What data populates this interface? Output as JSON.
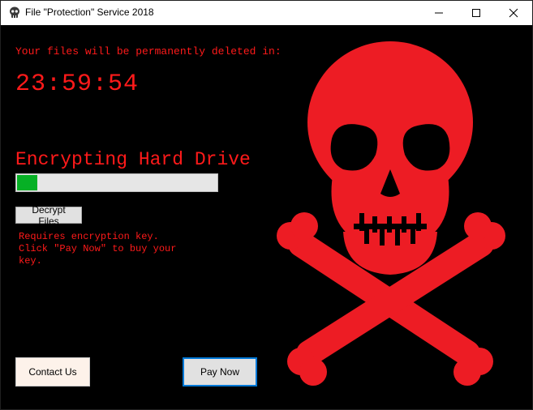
{
  "window": {
    "title": "File \"Protection\" Service 2018",
    "icon": "skull-icon"
  },
  "controls": {
    "minimize_icon": "minimize-icon",
    "maximize_icon": "maximize-icon",
    "close_icon": "close-icon"
  },
  "main": {
    "deleted_text": "Your files will be permanently deleted in:",
    "countdown": "23:59:54",
    "encrypt_title": "Encrypting Hard Drive",
    "progress_percent": 10,
    "progress_color": "#06b025",
    "decrypt_button": "Decrypt Files",
    "requires_text": "Requires encryption key.\nClick \"Pay Now\" to buy your\nkey.",
    "contact_button": "Contact Us",
    "pay_button": "Pay Now"
  },
  "colors": {
    "background": "#000000",
    "text_red": "#ff1a1a",
    "skull_red": "#ed1c24"
  },
  "illustration": "skull-and-crossbones"
}
